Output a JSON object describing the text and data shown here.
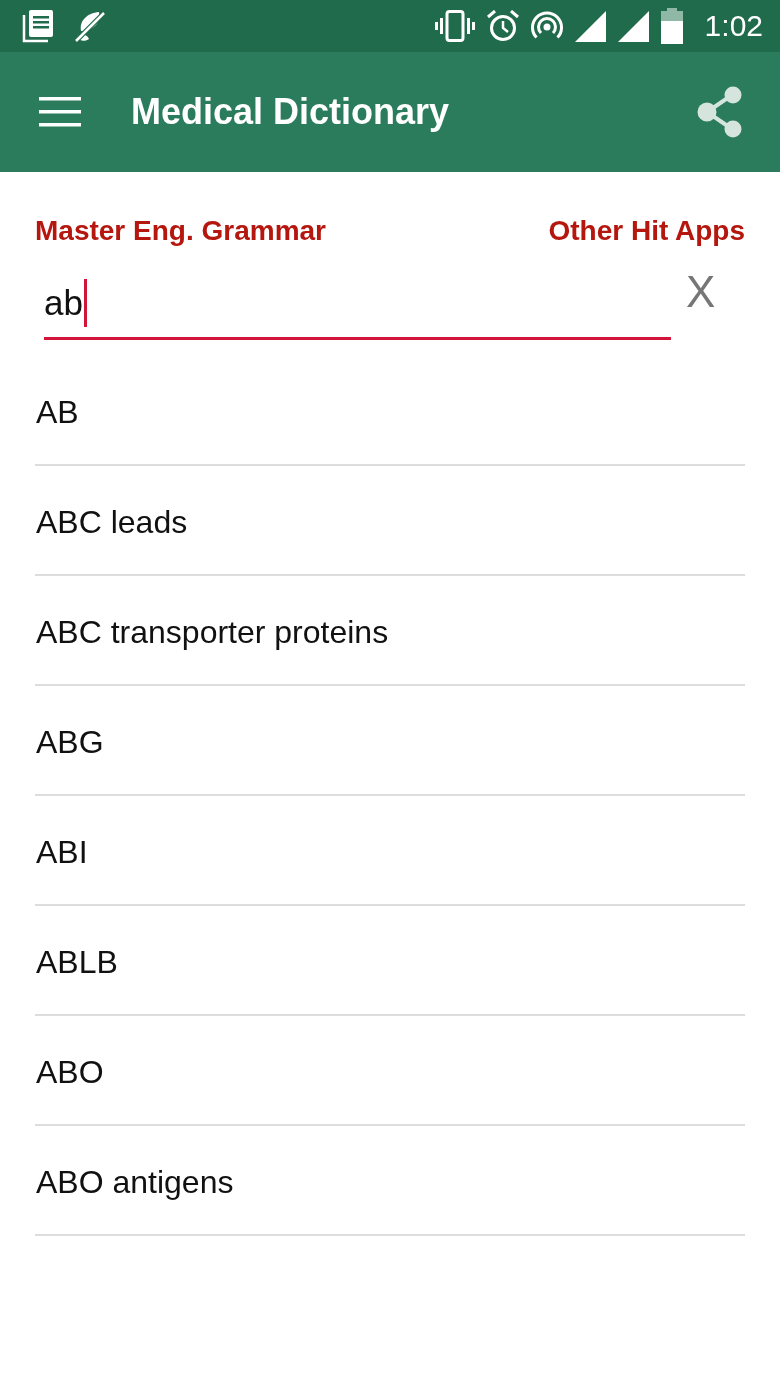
{
  "status_bar": {
    "time": "1:02"
  },
  "app_bar": {
    "title": "Medical Dictionary"
  },
  "links": [
    {
      "label": "Master Eng. Grammar"
    },
    {
      "label": "Other Hit Apps"
    }
  ],
  "search": {
    "value": "ab",
    "focused": true,
    "clear_label": "X"
  },
  "results": [
    {
      "term": "AB"
    },
    {
      "term": "ABC leads"
    },
    {
      "term": "ABC transporter proteins"
    },
    {
      "term": "ABG"
    },
    {
      "term": "ABI"
    },
    {
      "term": "ABLB"
    },
    {
      "term": "ABO"
    },
    {
      "term": "ABO antigens"
    }
  ]
}
